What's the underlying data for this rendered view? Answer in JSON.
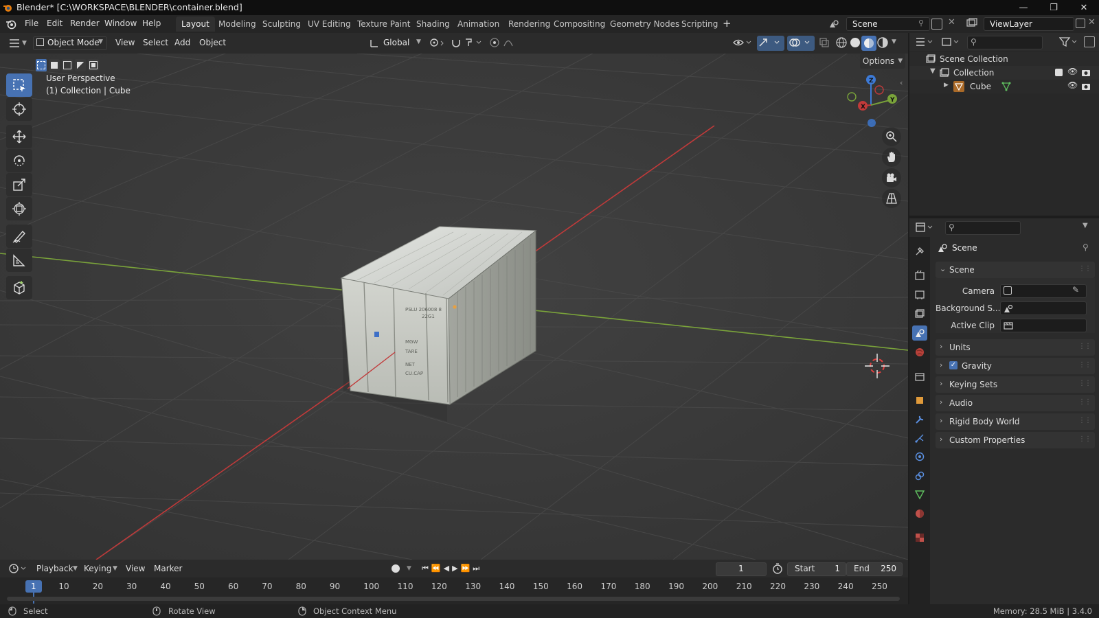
{
  "window": {
    "title": "Blender* [C:\\WORKSPACE\\BLENDER\\container.blend]"
  },
  "menu": [
    "File",
    "Edit",
    "Render",
    "Window",
    "Help"
  ],
  "workspaces": [
    "Layout",
    "Modeling",
    "Sculpting",
    "UV Editing",
    "Texture Paint",
    "Shading",
    "Animation",
    "Rendering",
    "Compositing",
    "Geometry Nodes",
    "Scripting"
  ],
  "active_workspace": "Layout",
  "scene_selector": "Scene",
  "viewlayer_selector": "ViewLayer",
  "viewport_header": {
    "mode": "Object Mode",
    "menus": [
      "View",
      "Select",
      "Add",
      "Object"
    ],
    "transform_orientation": "Global",
    "options_label": "Options"
  },
  "viewport": {
    "perspective_label": "User Perspective",
    "context_label": "(1) Collection | Cube",
    "gizmo_axes": {
      "x": "X",
      "y": "Y",
      "z": "Z"
    }
  },
  "outliner": {
    "scene_collection": "Scene Collection",
    "collection": "Collection",
    "object": "Cube"
  },
  "properties": {
    "header": "Scene",
    "section": "Scene",
    "fields": {
      "camera": "Camera",
      "background_scene": "Background S...",
      "active_clip": "Active Clip"
    },
    "panels": [
      "Units",
      "Gravity",
      "Keying Sets",
      "Audio",
      "Rigid Body World",
      "Custom Properties"
    ],
    "gravity_checked": true
  },
  "timeline": {
    "menus": [
      "Playback",
      "Keying",
      "View",
      "Marker"
    ],
    "current_frame": "1",
    "start_label": "Start",
    "start_value": "1",
    "end_label": "End",
    "end_value": "250",
    "ticks": [
      "1",
      "10",
      "20",
      "30",
      "40",
      "50",
      "60",
      "70",
      "80",
      "90",
      "100",
      "110",
      "120",
      "130",
      "140",
      "150",
      "160",
      "170",
      "180",
      "190",
      "200",
      "210",
      "220",
      "230",
      "240",
      "250"
    ]
  },
  "statusbar": {
    "select": "Select",
    "rotate": "Rotate View",
    "context_menu": "Object Context Menu",
    "memory": "Memory: 28.5 MiB | 3.4.0"
  },
  "container_markings": [
    "PSLU 206008 8",
    "22G1",
    "MGW",
    "TARE",
    "NET",
    "CU.CAP"
  ],
  "colors": {
    "accent": "#4772b3",
    "x_axis": "#c13a3a",
    "y_axis": "#7aa33a",
    "z_axis": "#3d7ad6",
    "container": "#c6c9c3"
  }
}
